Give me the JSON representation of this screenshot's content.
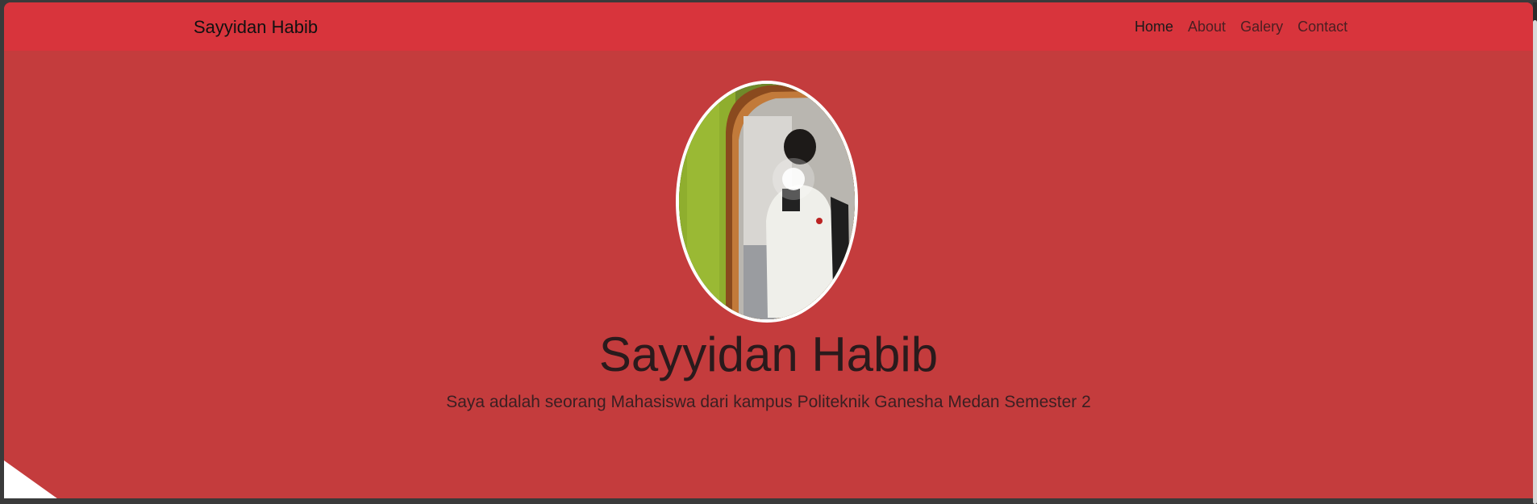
{
  "navbar": {
    "brand": "Sayyidan Habib",
    "links": [
      {
        "label": "Home",
        "active": true
      },
      {
        "label": "About",
        "active": false
      },
      {
        "label": "Galery",
        "active": false
      },
      {
        "label": "Contact",
        "active": false
      }
    ]
  },
  "hero": {
    "title": "Sayyidan Habib",
    "subtitle": "Saya adalah seorang Mahasiswa dari kampus Politeknik Ganesha Medan Semester 2"
  },
  "colors": {
    "navbar_bg": "#d8343c",
    "hero_bg": "#c43c3d",
    "avatar_border": "#ffffff"
  }
}
